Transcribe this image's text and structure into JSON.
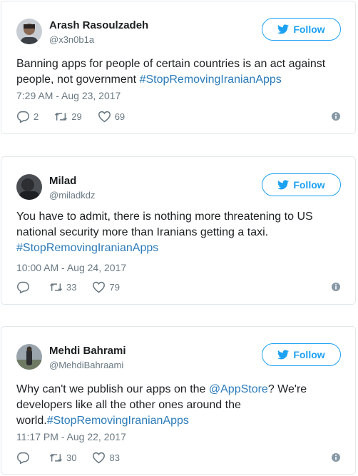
{
  "tweets": [
    {
      "name": "Arash Rasoulzadeh",
      "handle": "@x3n0b1a",
      "follow_label": "Follow",
      "text_plain": "Banning apps for people of certain countries is an act against people, not government ",
      "hashtag": "#StopRemovingIranianApps",
      "time": "7:29 AM - Aug 23, 2017",
      "replies": "2",
      "retweets": "29",
      "likes": "69"
    },
    {
      "name": "Milad",
      "handle": "@miladkdz",
      "follow_label": "Follow",
      "text_plain": "You have to admit, there is nothing more threatening to US national security more than Iranians getting a taxi.",
      "hashtag": "#StopRemovingIranianApps",
      "time": "10:00 AM - Aug 24, 2017",
      "replies": "",
      "retweets": "33",
      "likes": "79"
    },
    {
      "name": "Mehdi Bahrami",
      "handle": "@MehdiBahraami",
      "follow_label": "Follow",
      "text_before": "Why can't we publish our apps on the ",
      "mention": "@AppStore",
      "text_after": "? We're developers like all the other ones around the world.",
      "hashtag": "#StopRemovingIranianApps",
      "time": "11:17 PM - Aug 22, 2017",
      "replies": "",
      "retweets": "30",
      "likes": "83"
    }
  ],
  "colors": {
    "accent": "#1da1f2",
    "link": "#2b7bb9",
    "meta": "#697882",
    "border": "#e1e8ed"
  }
}
